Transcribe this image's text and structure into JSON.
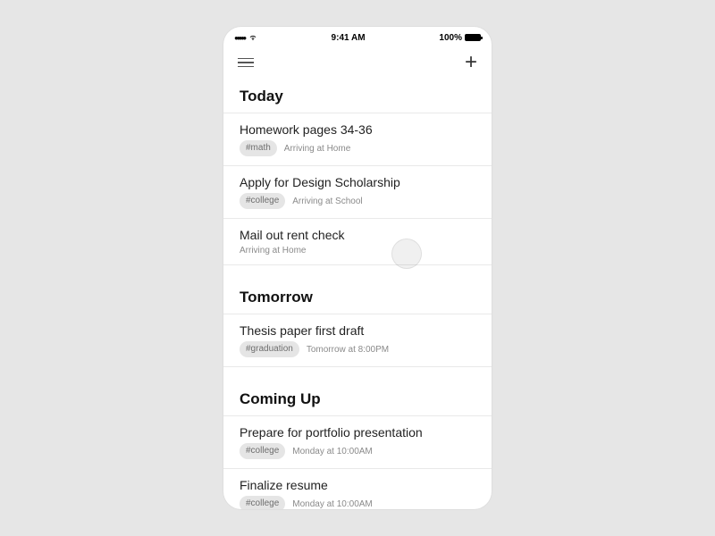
{
  "statusbar": {
    "time": "9:41 AM",
    "battery_text": "100%"
  },
  "sections": {
    "today": {
      "header": "Today",
      "items": [
        {
          "title": "Homework pages 34-36",
          "tag": "#math",
          "context": "Arriving at Home"
        },
        {
          "title": "Apply for Design Scholarship",
          "tag": "#college",
          "context": "Arriving at School"
        },
        {
          "title": "Mail out rent check",
          "tag": null,
          "context": "Arriving at Home"
        }
      ]
    },
    "tomorrow": {
      "header": "Tomorrow",
      "items": [
        {
          "title": "Thesis paper first draft",
          "tag": "#graduation",
          "context": "Tomorrow at 8:00PM"
        }
      ]
    },
    "coming_up": {
      "header": "Coming Up",
      "items": [
        {
          "title": "Prepare for portfolio presentation",
          "tag": "#college",
          "context": "Monday at 10:00AM"
        },
        {
          "title": "Finalize resume",
          "tag": "#college",
          "context": "Monday at 10:00AM"
        }
      ]
    }
  }
}
